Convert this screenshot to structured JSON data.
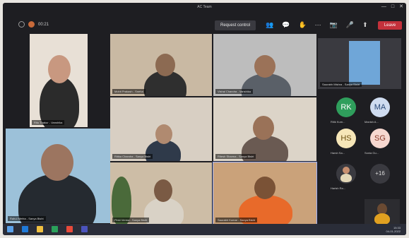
{
  "window": {
    "title": "AC Team",
    "controls": [
      "—",
      "□",
      "✕"
    ]
  },
  "toolbar": {
    "timer": "00:21",
    "request_control": "Request control",
    "leave": "Leave",
    "icons": [
      "camera-icon",
      "mic-icon",
      "share-icon",
      "more-icon",
      "people-icon",
      "chat-icon",
      "hand-icon"
    ]
  },
  "participants": [
    {
      "name": "Ritu Thakur - Vanshika",
      "color": "#e9e1d6"
    },
    {
      "name": "Mohit Prakash - Sneha",
      "color": "#c9b9a3"
    },
    {
      "name": "Vishal Chandra - Vanshika",
      "color": "#bdbdbd"
    },
    {
      "name": "Rahul Mehta - Sanya Bisht",
      "color": "#9cc1d9"
    },
    {
      "name": "Ritesh Sharma - Sanya Bisht",
      "color": "#aab6cd"
    },
    {
      "name": "Ritika Chandra - Sanya Bisht",
      "color": "#d8cfc3"
    },
    {
      "name": "Astha Kumari - Sanya Bisht",
      "color": "#cdbda6"
    },
    {
      "name": "Pinki Verma - Sanya Bisht",
      "color": "#a9b89a"
    },
    {
      "name": "Saurabh Kumar - Sanya Bisht",
      "color": "#caa27a"
    }
  ],
  "side": {
    "shared_screen_name": "Saurabh Mishra - Sanya Bisht",
    "avatars": [
      {
        "initials": "RK",
        "name": "Ritik Kum...",
        "bg": "#2f9e5c",
        "fg": "#ffffff"
      },
      {
        "initials": "MA",
        "name": "Manish A...",
        "bg": "#cfdcf0",
        "fg": "#2b4a78"
      },
      {
        "initials": "HS",
        "name": "Harsh Sa...",
        "bg": "#f6e6b8",
        "fg": "#6b4e10"
      },
      {
        "initials": "SG",
        "name": "Sonia Gu...",
        "bg": "#f7d8d0",
        "fg": "#8a3a28"
      },
      {
        "initials": "",
        "name": "Harish Ra...",
        "bg": "#3a3a40",
        "fg": "#ffffff"
      },
      {
        "initials": "+16",
        "name": "",
        "bg": "#3a3a40",
        "fg": "#dddddd"
      }
    ]
  },
  "taskbar": {
    "time": "15:33",
    "date": "04-01-2022"
  }
}
